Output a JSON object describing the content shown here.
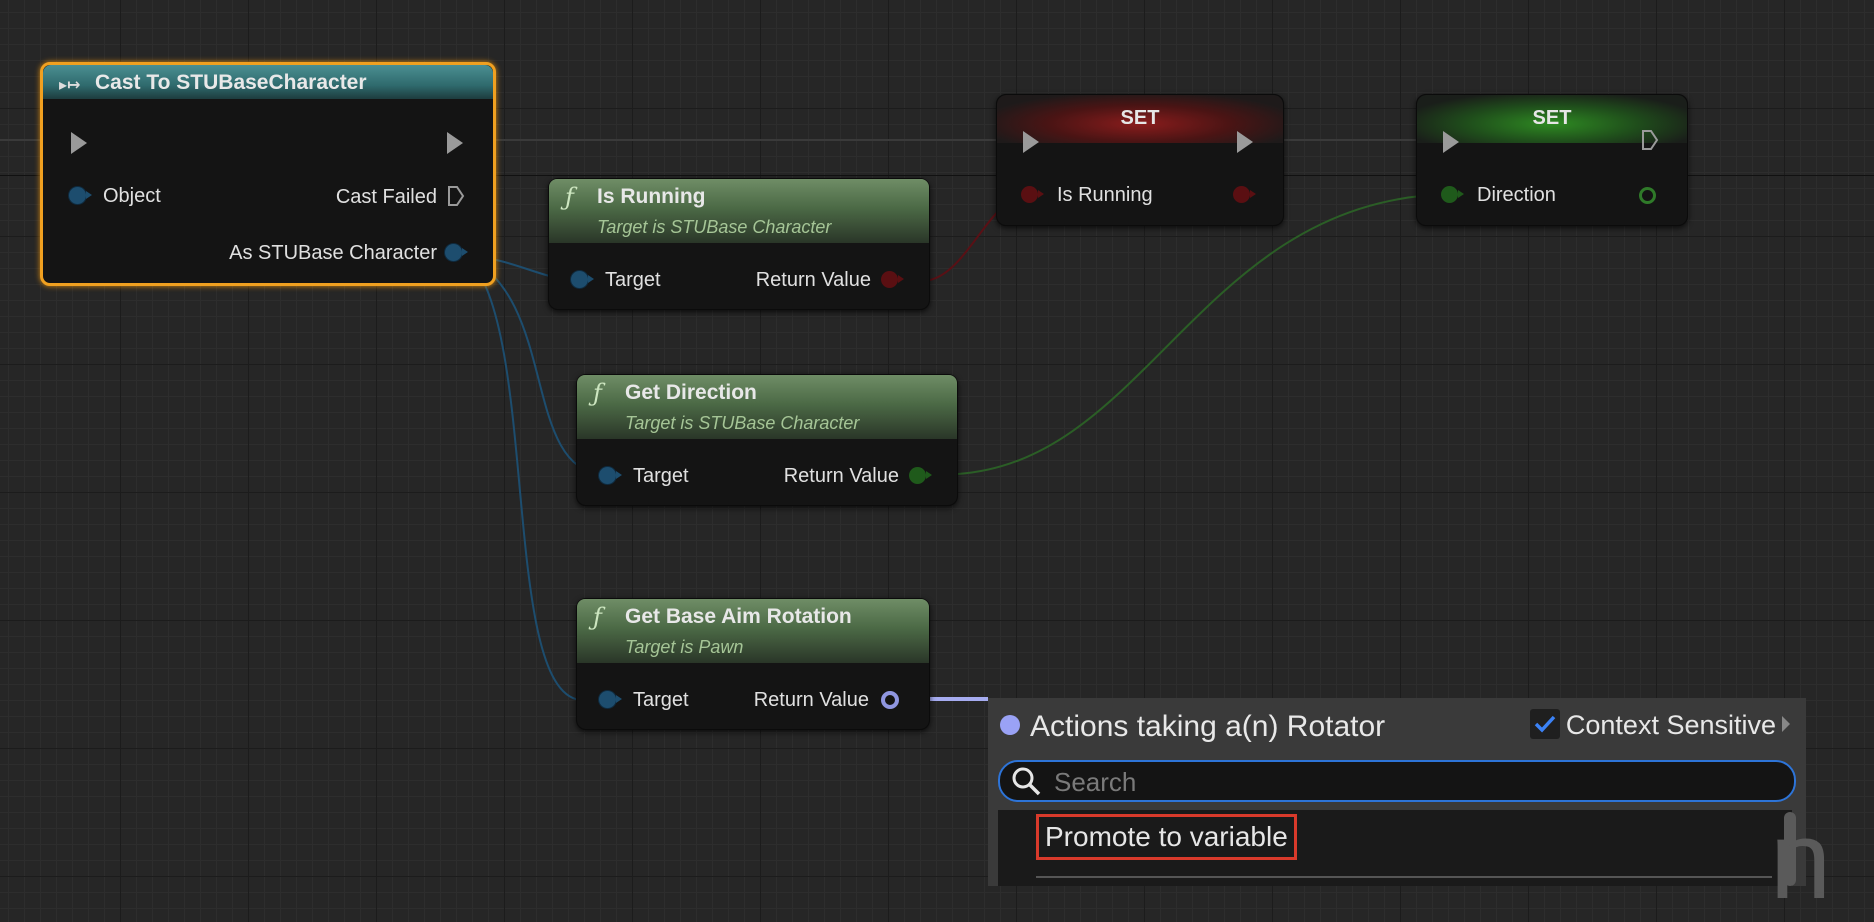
{
  "colors": {
    "selection": "#f0a020",
    "object_pin": "#1d4d6e",
    "bool_pin": "#5a0f12",
    "float_pin": "#1f5a1b",
    "rotator_pin": "#8f96e0",
    "search_focus": "#2d74d8",
    "highlight_box": "#d93a2b"
  },
  "nodes": {
    "cast": {
      "title": "Cast To STUBaseCharacter",
      "pin_object": "Object",
      "pin_cast_failed": "Cast Failed",
      "pin_as": "As STUBase Character"
    },
    "is_running": {
      "title": "Is Running",
      "subtitle": "Target is STUBase Character",
      "pin_target": "Target",
      "pin_return": "Return Value"
    },
    "get_direction": {
      "title": "Get Direction",
      "subtitle": "Target is STUBase Character",
      "pin_target": "Target",
      "pin_return": "Return Value"
    },
    "get_base_aim": {
      "title": "Get Base Aim Rotation",
      "subtitle": "Target is Pawn",
      "pin_target": "Target",
      "pin_return": "Return Value"
    },
    "set_running": {
      "title": "SET",
      "pin": "Is Running"
    },
    "set_direction": {
      "title": "SET",
      "pin": "Direction"
    }
  },
  "popup": {
    "title": "Actions taking a(n) Rotator",
    "context_sensitive_label": "Context Sensitive",
    "context_sensitive_checked": true,
    "search_placeholder": "Search",
    "search_value": "",
    "items": [
      "Promote to variable"
    ]
  },
  "icons": [
    "function-icon",
    "exec-pin-icon",
    "search-icon",
    "checkmark-icon",
    "expand-arrow-icon"
  ]
}
